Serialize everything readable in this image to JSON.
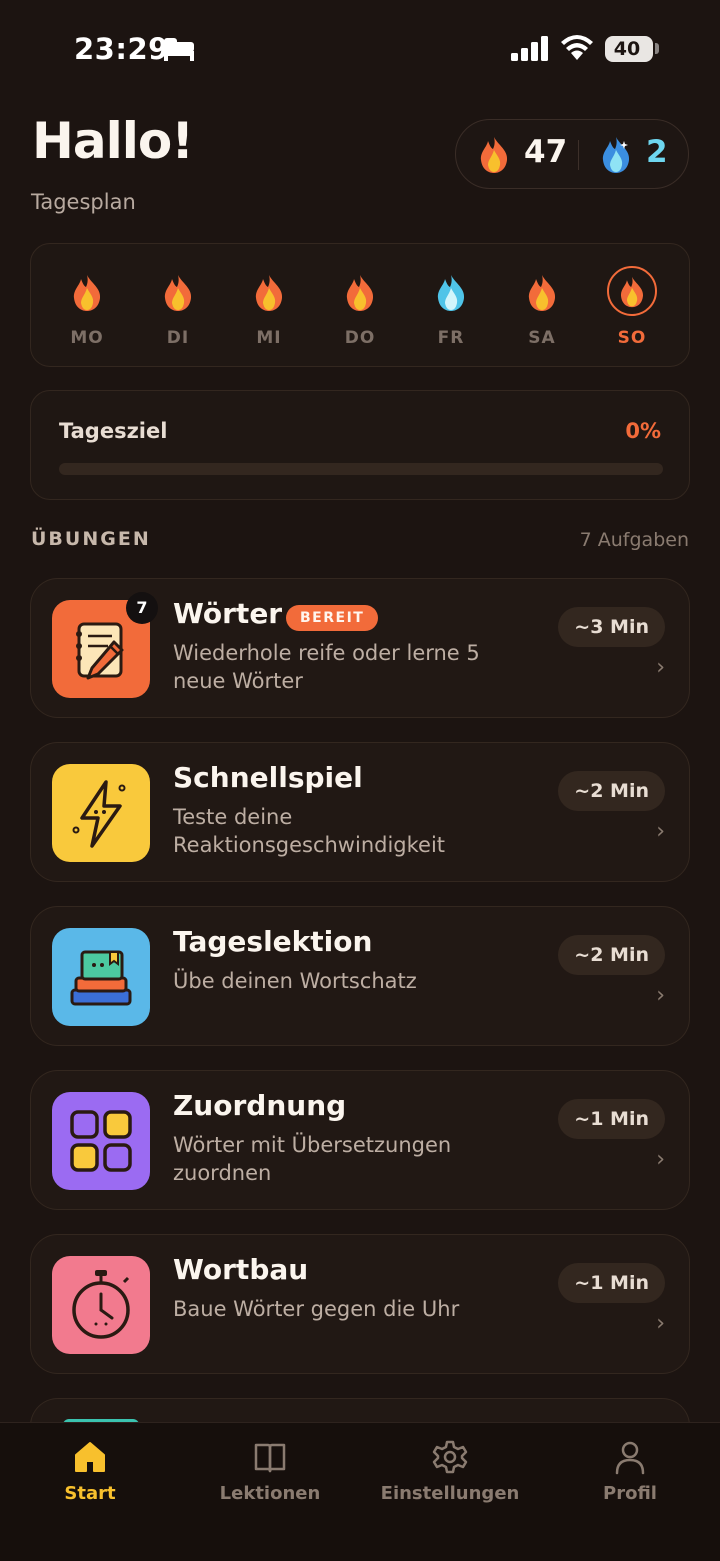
{
  "status_bar": {
    "time": "23:29",
    "battery": "40"
  },
  "header": {
    "greeting": "Hallo!",
    "subtitle": "Tagesplan",
    "streak": {
      "flame_count": "47",
      "water_count": "2"
    }
  },
  "week": {
    "days": [
      {
        "label": "MO",
        "icon": "flame-icon"
      },
      {
        "label": "DI",
        "icon": "flame-icon"
      },
      {
        "label": "MI",
        "icon": "flame-icon"
      },
      {
        "label": "DO",
        "icon": "flame-icon"
      },
      {
        "label": "FR",
        "icon": "water-drop-icon"
      },
      {
        "label": "SA",
        "icon": "flame-icon"
      },
      {
        "label": "SO",
        "icon": "flame-icon",
        "today": true
      }
    ]
  },
  "goal": {
    "label": "Tagesziel",
    "value": "0%",
    "progress": 0
  },
  "exercises": {
    "title": "ÜBUNGEN",
    "count": "7 Aufgaben",
    "items": [
      {
        "title": "Wörter",
        "badge": "7",
        "ready": "BEREIT",
        "desc": "Wiederhole reife oder lerne 5 neue Wörter",
        "time": "~3 Min",
        "icon": "notebook-pencil-icon",
        "color": "#f26b3a"
      },
      {
        "title": "Schnellspiel",
        "desc": "Teste deine Reaktionsgeschwindigkeit",
        "time": "~2 Min",
        "icon": "lightning-icon",
        "color": "#f9c93c"
      },
      {
        "title": "Tageslektion",
        "desc": "Übe deinen Wortschatz",
        "time": "~2 Min",
        "icon": "book-stack-icon",
        "color": "#5ab8e8"
      },
      {
        "title": "Zuordnung",
        "desc": "Wörter mit Übersetzungen zuordnen",
        "time": "~1 Min",
        "icon": "grid-icon",
        "color": "#9b6bf2"
      },
      {
        "title": "Wortbau",
        "desc": "Baue Wörter gegen die Uhr",
        "time": "~1 Min",
        "icon": "stopwatch-icon",
        "color": "#f27a8e"
      }
    ],
    "chevron": "›"
  },
  "nav": {
    "items": [
      {
        "label": "Start",
        "icon": "home-icon",
        "active": true
      },
      {
        "label": "Lektionen",
        "icon": "book-icon"
      },
      {
        "label": "Einstellungen",
        "icon": "gear-icon"
      },
      {
        "label": "Profil",
        "icon": "person-icon"
      }
    ]
  },
  "colors": {
    "accent": "#f26b3a",
    "nav_active": "#f8c02d",
    "water": "#6ed6ef",
    "background": "#1c1411"
  }
}
